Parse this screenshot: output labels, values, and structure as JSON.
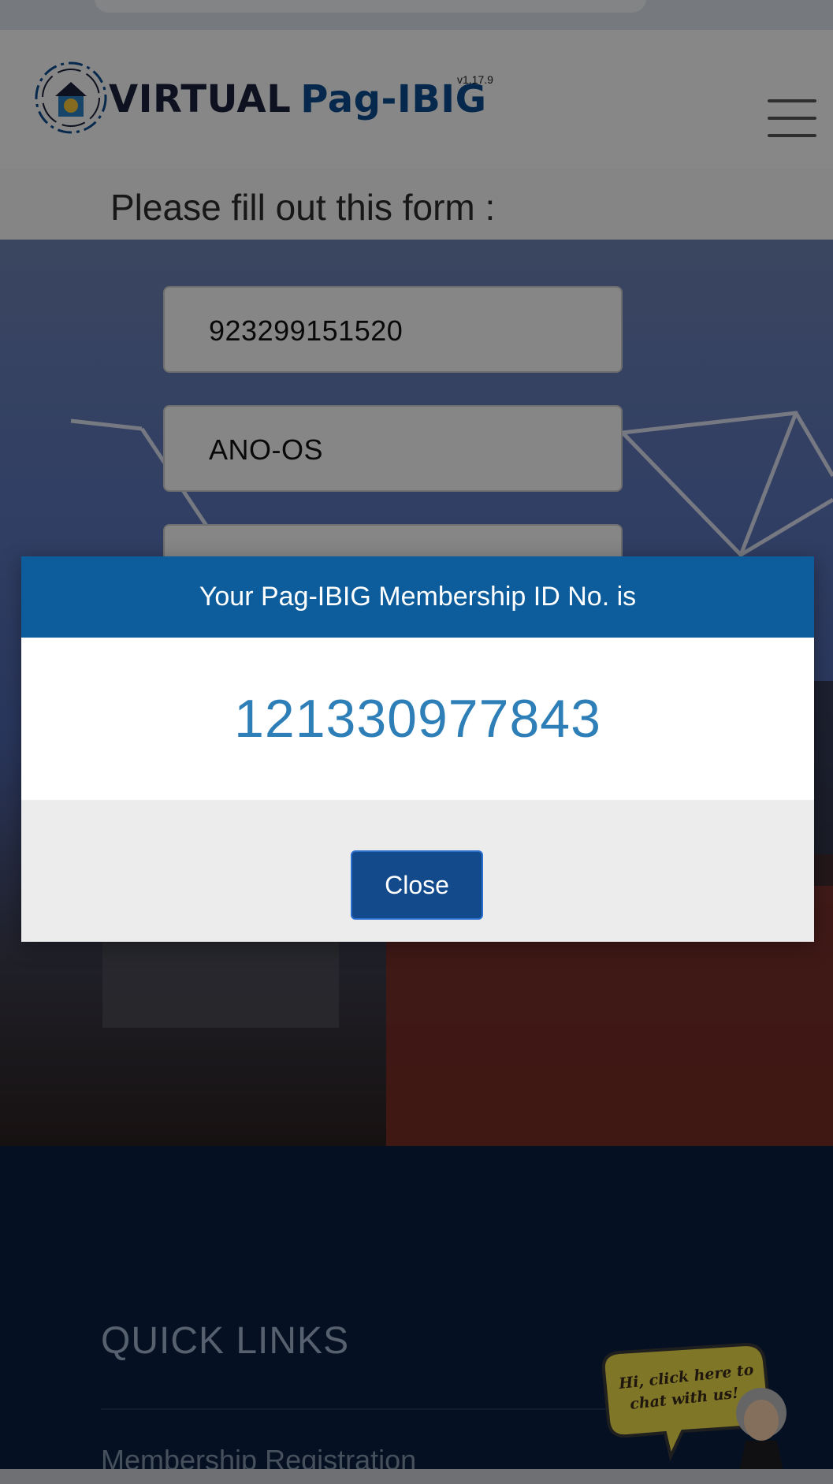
{
  "header": {
    "logo_word1": "VIRTUAL",
    "logo_word2": "Pag-IBIG",
    "version": "v1.17.9",
    "menu_icon": "hamburger-menu-icon"
  },
  "form": {
    "title": "Please fill out this form :",
    "field1_value": "923299151520",
    "field2_value": "ANO-OS"
  },
  "footer": {
    "heading": "QUICK LINKS",
    "link1": "Membership Registration",
    "chat_bubble": "Hi, click here to chat with us!"
  },
  "modal": {
    "title": "Your Pag-IBIG Membership ID No. is",
    "member_id": "121330977843",
    "close_label": "Close"
  },
  "colors": {
    "modal_header": "#0d5c9b",
    "member_id_text": "#2e7fb8",
    "close_button": "#124a8c",
    "footer_bg": "#0a1f3e"
  }
}
